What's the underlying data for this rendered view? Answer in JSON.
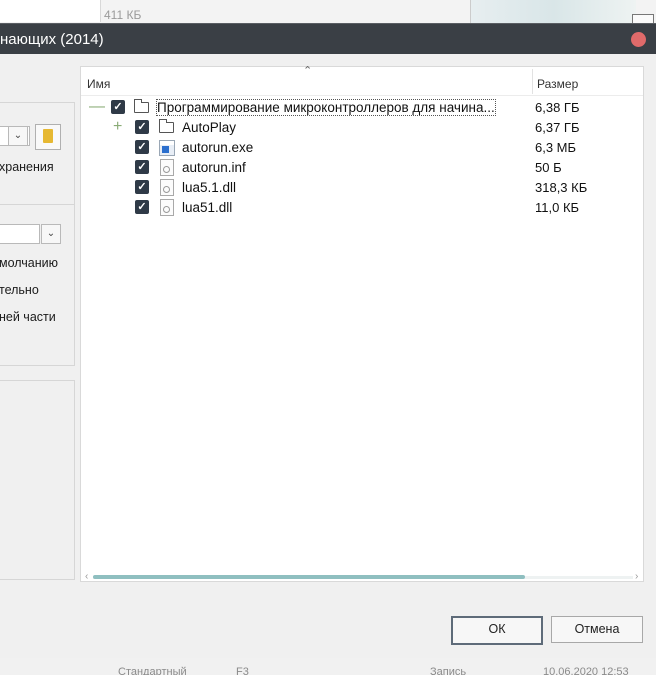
{
  "background": {
    "size_text": "411 КБ",
    "status_row": [
      "Стандартный",
      "F3",
      "Запись",
      "10.06.2020 12:53"
    ]
  },
  "dialog": {
    "title": "нающих (2014)",
    "left_panel": {
      "save_label": "хранения",
      "option_default": "молчанию",
      "option_relative": "тельно",
      "option_lower": "ней части"
    },
    "tree": {
      "col_name": "Имя",
      "col_size": "Размер",
      "rows": [
        {
          "name": "Программирование микроконтроллеров для начина...",
          "size": "6,38 ГБ",
          "expander": "—",
          "icon": "folder-open-icon",
          "checked": true
        },
        {
          "name": "AutoPlay",
          "size": "6,37 ГБ",
          "expander": "+",
          "icon": "folder-open-icon",
          "checked": true
        },
        {
          "name": "autorun.exe",
          "size": "6,3 МБ",
          "icon": "exe-file-icon",
          "checked": true
        },
        {
          "name": "autorun.inf",
          "size": "50 Б",
          "icon": "settings-file-icon",
          "checked": true
        },
        {
          "name": "lua5.1.dll",
          "size": "318,3 КБ",
          "icon": "dll-file-icon",
          "checked": true
        },
        {
          "name": "lua51.dll",
          "size": "11,0 КБ",
          "icon": "dll-file-icon",
          "checked": true
        }
      ]
    },
    "buttons": {
      "ok": "ОК",
      "cancel": "Отмена"
    }
  }
}
